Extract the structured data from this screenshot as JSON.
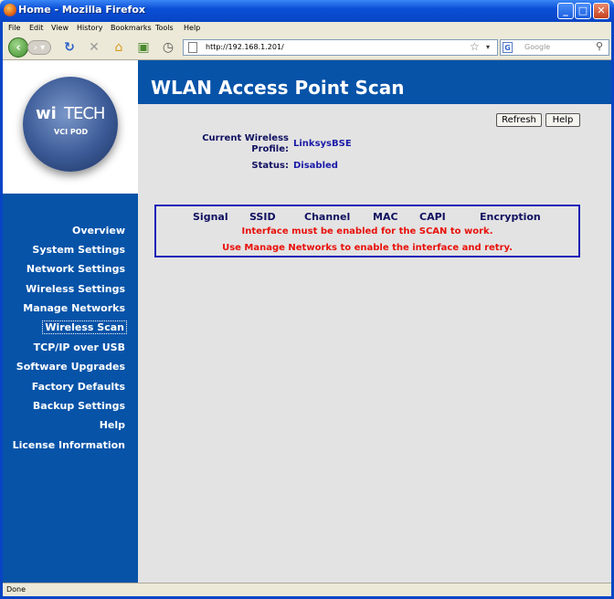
{
  "window": {
    "title": "Home - Mozilla Firefox"
  },
  "menu": [
    "File",
    "Edit",
    "View",
    "History",
    "Bookmarks",
    "Tools",
    "Help"
  ],
  "address": {
    "url": "http://192.168.1.201/"
  },
  "search": {
    "placeholder": "Google",
    "engine_icon": "G"
  },
  "logo": {
    "wi": "wi",
    "tech": "TECH",
    "sub": "VCI POD"
  },
  "sidebar": {
    "items": [
      "Overview",
      "System Settings",
      "Network Settings",
      "Wireless Settings",
      "Manage Networks",
      "Wireless Scan",
      "TCP/IP over USB",
      "Software Upgrades",
      "Factory Defaults",
      "Backup Settings",
      "Help",
      "License Information"
    ],
    "active": "Wireless Scan"
  },
  "header": {
    "title": "WLAN Access Point Scan"
  },
  "buttons": {
    "refresh": "Refresh",
    "help": "Help"
  },
  "profile": {
    "label_line1": "Current Wireless",
    "label_line2": "Profile:",
    "value": "LinksysBSE"
  },
  "status": {
    "label": "Status:",
    "value": "Disabled"
  },
  "scan_table": {
    "columns": [
      "Signal",
      "SSID",
      "Channel",
      "MAC",
      "CAPI",
      "Encryption"
    ],
    "error_line1": "Interface must be enabled for the SCAN to work.",
    "error_line2": "Use Manage Networks to enable the interface and retry."
  },
  "statusbar": {
    "text": "Done"
  },
  "colors": {
    "nav_blue": "#0653a8",
    "error_red": "#e8100a",
    "content_gray": "#e3e3e3"
  }
}
